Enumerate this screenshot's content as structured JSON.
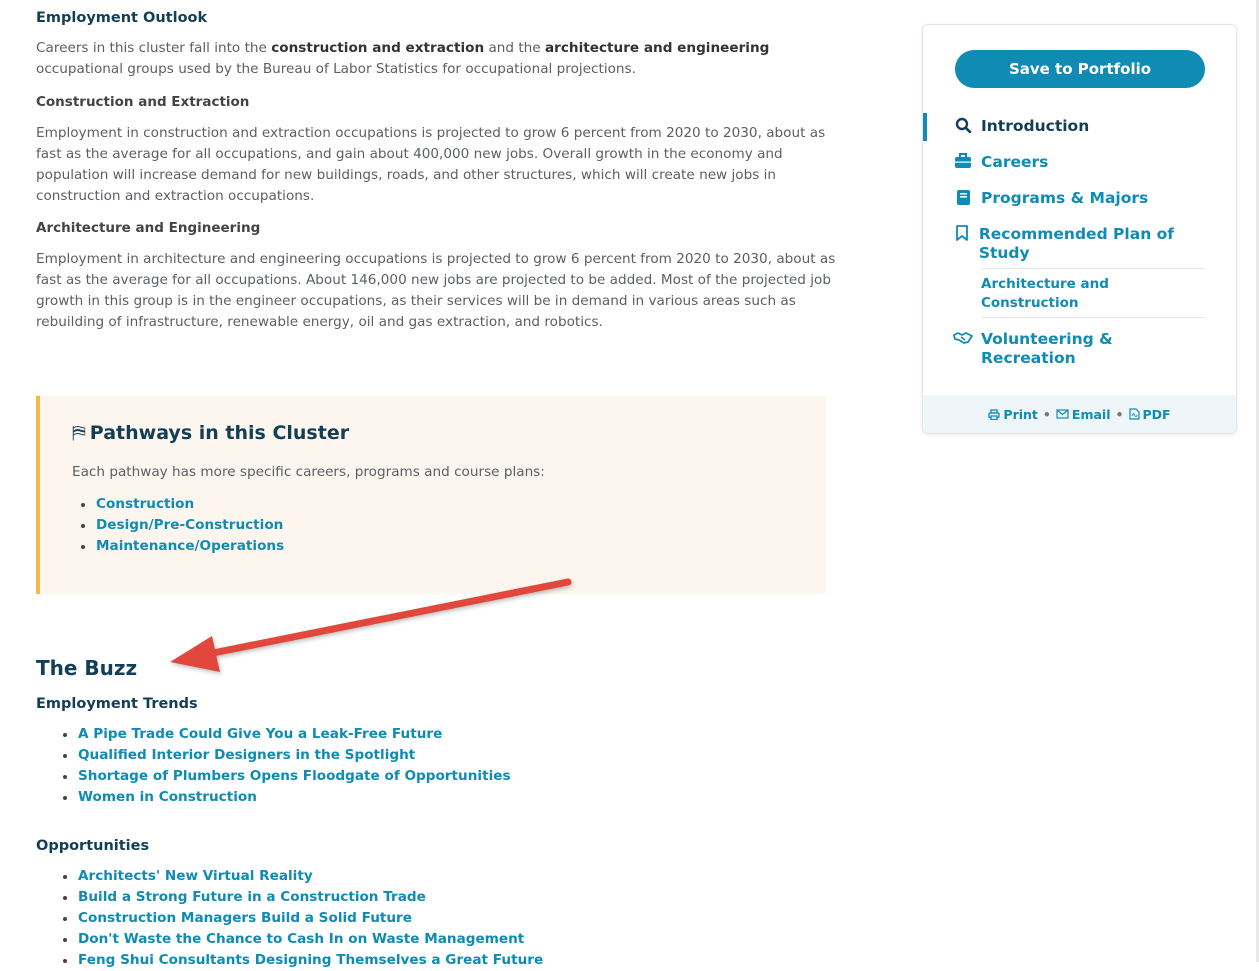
{
  "main": {
    "outlook_heading": "Employment Outlook",
    "outlook_intro_1": "Careers in this cluster fall into the ",
    "outlook_intro_b1": "construction and extraction",
    "outlook_intro_2": " and the ",
    "outlook_intro_b2": "architecture and engineering",
    "outlook_intro_3": " occupational groups used by the Bureau of Labor Statistics for occupational projections.",
    "construction_heading": "Construction and Extraction",
    "construction_text": "Employment in construction and extraction occupations is projected to grow 6 percent from 2020 to 2030, about as fast as the average for all occupations, and gain about 400,000 new jobs. Overall growth in the economy and population will increase demand for new buildings, roads, and other structures, which will create new jobs in construction and extraction occupations.",
    "architecture_heading": "Architecture and Engineering",
    "architecture_text": "Employment in architecture and engineering occupations is projected to grow 6 percent from 2020 to 2030, about as fast as the average for all occupations. About 146,000 new jobs are projected to be added. Most of the projected job growth in this group is in the engineer occupations, as their services will be in demand in various areas such as rebuilding of infrastructure, renewable energy, oil and gas extraction, and robotics."
  },
  "pathways": {
    "title": "Pathways in this Cluster",
    "intro": "Each pathway has more specific careers, programs and course plans:",
    "items": [
      "Construction",
      "Design/Pre-Construction",
      "Maintenance/Operations"
    ]
  },
  "buzz": {
    "title": "The Buzz",
    "trends_heading": "Employment Trends",
    "trends": [
      "A Pipe Trade Could Give You a Leak-Free Future",
      "Qualified Interior Designers in the Spotlight",
      "Shortage of Plumbers Opens Floodgate of Opportunities",
      "Women in Construction"
    ],
    "opportunities_heading": "Opportunities",
    "opportunities": [
      "Architects' New Virtual Reality",
      "Build a Strong Future in a Construction Trade",
      "Construction Managers Build a Solid Future",
      "Don't Waste the Chance to Cash In on Waste Management",
      "Feng Shui Consultants Designing Themselves a Great Future"
    ]
  },
  "sidebar": {
    "save_label": "Save to Portfolio",
    "nav": [
      {
        "label": "Introduction",
        "icon": "search-icon"
      },
      {
        "label": "Careers",
        "icon": "briefcase-icon"
      },
      {
        "label": "Programs & Majors",
        "icon": "book-icon"
      },
      {
        "label": "Recommended Plan of Study",
        "icon": "bookmark-icon"
      },
      {
        "label": "Volunteering & Recreation",
        "icon": "handshake-icon"
      }
    ],
    "sub_item": "Architecture and Construction",
    "footer": {
      "print": "Print",
      "email": "Email",
      "pdf": "PDF",
      "separator": "•"
    }
  },
  "colors": {
    "accent": "#0f8bb4",
    "heading": "#123f56",
    "callout_bg": "#fdf6ee",
    "callout_border": "#f2b84b",
    "arrow": "#e0463c"
  }
}
